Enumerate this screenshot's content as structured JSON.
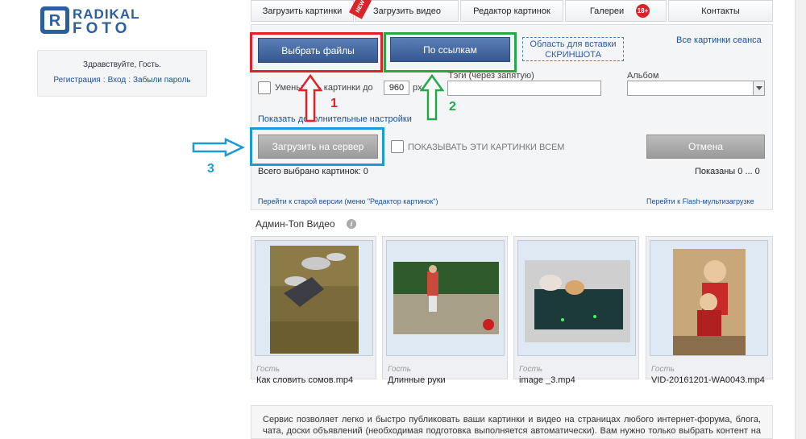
{
  "logo": {
    "top": "RADIKAL",
    "bottom": "FOTO"
  },
  "userbox": {
    "greeting": "Здравствуйте, Гость.",
    "register": "Регистрация",
    "login": "Вход",
    "forgot": "Забыли пароль",
    "sep": ":"
  },
  "tabs": [
    {
      "label": "Загрузить картинки"
    },
    {
      "label": "Загрузить видео",
      "ribbon": "NEW"
    },
    {
      "label": "Редактор картинок"
    },
    {
      "label": "Галереи",
      "badge": "18+"
    },
    {
      "label": "Контакты"
    }
  ],
  "upload": {
    "choose_files": "Выбрать файлы",
    "by_links": "По ссылкам",
    "paste_line1": "Область для вставки",
    "paste_line2": "СКРИНШОТА",
    "session_link": "Все картинки сеанса",
    "reduce_label": "Уменьшить картинки до",
    "reduce_value": "960",
    "reduce_unit": "px",
    "tags_label": "Тэги (через запятую)",
    "tags_value": "",
    "album_label": "Альбом",
    "album_value": "",
    "more_settings": "Показать дополнительные настройки",
    "upload_to_server": "Загрузить на сервер",
    "show_all_label": "ПОКАЗЫВАТЬ ЭТИ КАРТИНКИ ВСЕМ",
    "cancel": "Отмена",
    "total_selected": "Всего выбрано картинок: 0",
    "shown": "Показаны 0 ... 0",
    "old_version": "Перейти к старой версии (меню \"Редактор картинок\")",
    "flash_upload": "Перейти к Flash-мультизагрузке"
  },
  "annotations": {
    "n1": "1",
    "n2": "2",
    "n3": "3",
    "red": "#e32027",
    "green": "#26a84a",
    "blue": "#1c9ad6"
  },
  "video": {
    "title": "Админ-Топ Видео",
    "info_icon": "i",
    "items": [
      {
        "user": "Гость",
        "name": "Как словить сомов.mp4"
      },
      {
        "user": "Гость",
        "name": "Длинные руки"
      },
      {
        "user": "Гость",
        "name": "image _3.mp4"
      },
      {
        "user": "Гость",
        "name": "VID-20161201-WA0043.mp4"
      }
    ]
  },
  "description": "Сервис позволяет легко и быстро публиковать ваши картинки и видео на страницах любого интернет-форума, блога, чата, доски объявлений (необходимая подготовка выполняется автоматически). Вам нужно только выбрать контент на диске, нажать кнопку ЗАГРУЗИТЬ, и затем скопировать готовую ссылку в свое сообщение."
}
